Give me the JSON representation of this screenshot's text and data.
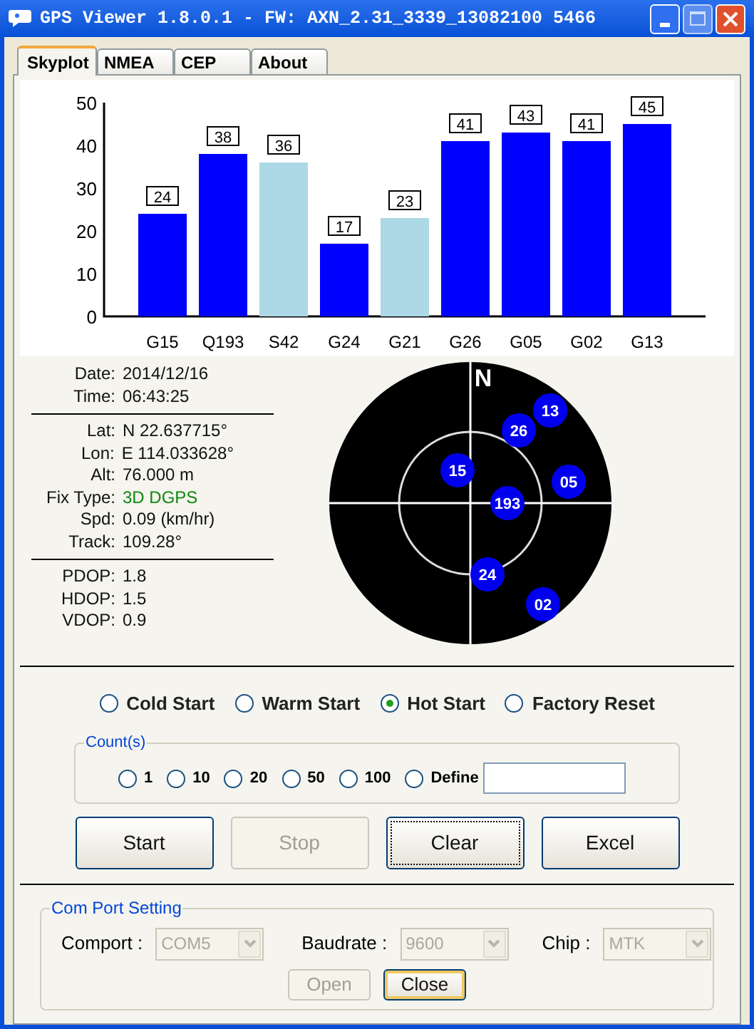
{
  "window": {
    "title": "GPS Viewer 1.8.0.1 - FW: AXN_2.31_3339_13082100 5466"
  },
  "tabs": [
    {
      "label": "Skyplot",
      "selected": true
    },
    {
      "label": "NMEA",
      "selected": false
    },
    {
      "label": "CEP",
      "selected": false
    },
    {
      "label": "About",
      "selected": false
    }
  ],
  "snr_chart": {
    "chart_data": {
      "type": "bar",
      "categories": [
        "G15",
        "Q193",
        "S42",
        "G24",
        "G21",
        "G26",
        "G05",
        "G02",
        "G13"
      ],
      "data_labels": true,
      "ylim": [
        0,
        50
      ],
      "yticks": [
        0,
        10,
        20,
        30,
        40,
        50
      ],
      "series": [
        {
          "color": "#0000ff",
          "values": [
            24,
            38,
            null,
            17,
            null,
            41,
            43,
            41,
            45
          ]
        },
        {
          "color": "#add8e6",
          "values": [
            null,
            null,
            36,
            null,
            23,
            null,
            null,
            null,
            null
          ]
        }
      ]
    }
  },
  "info_groups": [
    [
      {
        "label": "Date:",
        "value": "2014/12/16"
      },
      {
        "label": "Time:",
        "value": "06:43:25"
      }
    ],
    [
      {
        "label": "Lat:",
        "value": "N 22.637715°"
      },
      {
        "label": "Lon:",
        "value": "E 114.033628°"
      },
      {
        "label": "Alt:",
        "value": "76.000 m"
      },
      {
        "label": "Fix Type:",
        "value": "3D DGPS",
        "kind": "status"
      },
      {
        "label": "Spd:",
        "value": "0.09 (km/hr)"
      },
      {
        "label": "Track:",
        "value": "109.28°"
      }
    ],
    [
      {
        "label": "PDOP:",
        "value": "1.8"
      },
      {
        "label": "HDOP:",
        "value": "1.5"
      },
      {
        "label": "VDOP:",
        "value": "0.9"
      }
    ]
  ],
  "skyplot": {
    "north_label": "N",
    "satellites": [
      "13",
      "26",
      "15",
      "05",
      "193",
      "24",
      "02"
    ]
  },
  "start_modes": [
    {
      "label": "Cold Start",
      "selected": false
    },
    {
      "label": "Warm Start",
      "selected": false
    },
    {
      "label": "Hot Start",
      "selected": true
    },
    {
      "label": "Factory Reset",
      "selected": false
    }
  ],
  "counts": {
    "title": "Count(s)",
    "options": [
      {
        "label": "1",
        "selected": false
      },
      {
        "label": "10",
        "selected": false
      },
      {
        "label": "20",
        "selected": false
      },
      {
        "label": "50",
        "selected": false
      },
      {
        "label": "100",
        "selected": false
      },
      {
        "label": "Define",
        "selected": false
      }
    ]
  },
  "actions": [
    {
      "label": "Start",
      "disabled": false,
      "focused": false
    },
    {
      "label": "Stop",
      "disabled": true,
      "focused": false
    },
    {
      "label": "Clear",
      "disabled": false,
      "focused": true
    },
    {
      "label": "Excel",
      "disabled": false,
      "focused": false
    }
  ],
  "com_port": {
    "title": "Com Port Setting",
    "fields": [
      {
        "label": "Comport :",
        "value": "COM5",
        "disabled": true
      },
      {
        "label": "Baudrate :",
        "value": "9600",
        "disabled": true
      },
      {
        "label": "Chip :",
        "value": "MTK",
        "disabled": true
      }
    ],
    "buttons": [
      {
        "label": "Open",
        "disabled": true,
        "focused": false
      },
      {
        "label": "Close",
        "disabled": false,
        "focused": true
      }
    ]
  }
}
